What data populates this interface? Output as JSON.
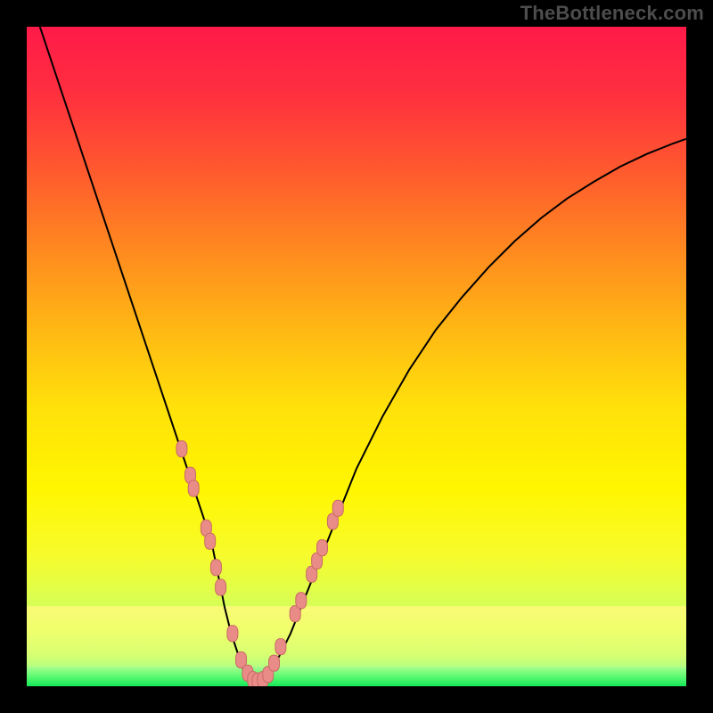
{
  "watermark": "TheBottleneck.com",
  "colors": {
    "frame": "#000000",
    "curve": "#000000",
    "marker_fill": "#e98b86",
    "marker_stroke": "#c96b66"
  },
  "chart_data": {
    "type": "line",
    "title": "",
    "xlabel": "",
    "ylabel": "",
    "xlim": [
      0,
      100
    ],
    "ylim": [
      0,
      100
    ],
    "grid": false,
    "legend": false,
    "series": [
      {
        "name": "bottleneck-curve",
        "x": [
          2,
          4,
          6,
          8,
          10,
          12,
          14,
          16,
          18,
          20,
          22,
          24,
          26,
          28,
          29,
          30,
          31,
          32,
          33,
          34,
          35,
          36,
          38,
          40,
          42,
          44,
          46,
          48,
          50,
          54,
          58,
          62,
          66,
          70,
          74,
          78,
          82,
          86,
          90,
          94,
          98,
          100
        ],
        "y": [
          100,
          94,
          88,
          82,
          76,
          70,
          64,
          58,
          52,
          46,
          40,
          34,
          28,
          22,
          17,
          12,
          8,
          5,
          2,
          1,
          0.5,
          1,
          4,
          8,
          13,
          18,
          23,
          28,
          33,
          41,
          48,
          54,
          59,
          63.5,
          67.5,
          71,
          74,
          76.5,
          78.8,
          80.7,
          82.3,
          83
        ]
      }
    ],
    "markers": [
      {
        "x": 23.5,
        "y": 36
      },
      {
        "x": 24.8,
        "y": 32
      },
      {
        "x": 25.3,
        "y": 30
      },
      {
        "x": 27.2,
        "y": 24
      },
      {
        "x": 27.8,
        "y": 22
      },
      {
        "x": 28.7,
        "y": 18
      },
      {
        "x": 29.4,
        "y": 15
      },
      {
        "x": 31.2,
        "y": 8
      },
      {
        "x": 32.5,
        "y": 4
      },
      {
        "x": 33.5,
        "y": 2
      },
      {
        "x": 34.3,
        "y": 1
      },
      {
        "x": 35.0,
        "y": 0.8
      },
      {
        "x": 35.8,
        "y": 1
      },
      {
        "x": 36.6,
        "y": 1.8
      },
      {
        "x": 37.5,
        "y": 3.5
      },
      {
        "x": 38.5,
        "y": 6
      },
      {
        "x": 40.7,
        "y": 11
      },
      {
        "x": 41.6,
        "y": 13
      },
      {
        "x": 43.2,
        "y": 17
      },
      {
        "x": 44.0,
        "y": 19
      },
      {
        "x": 44.8,
        "y": 21
      },
      {
        "x": 46.4,
        "y": 25
      },
      {
        "x": 47.2,
        "y": 27
      }
    ]
  }
}
